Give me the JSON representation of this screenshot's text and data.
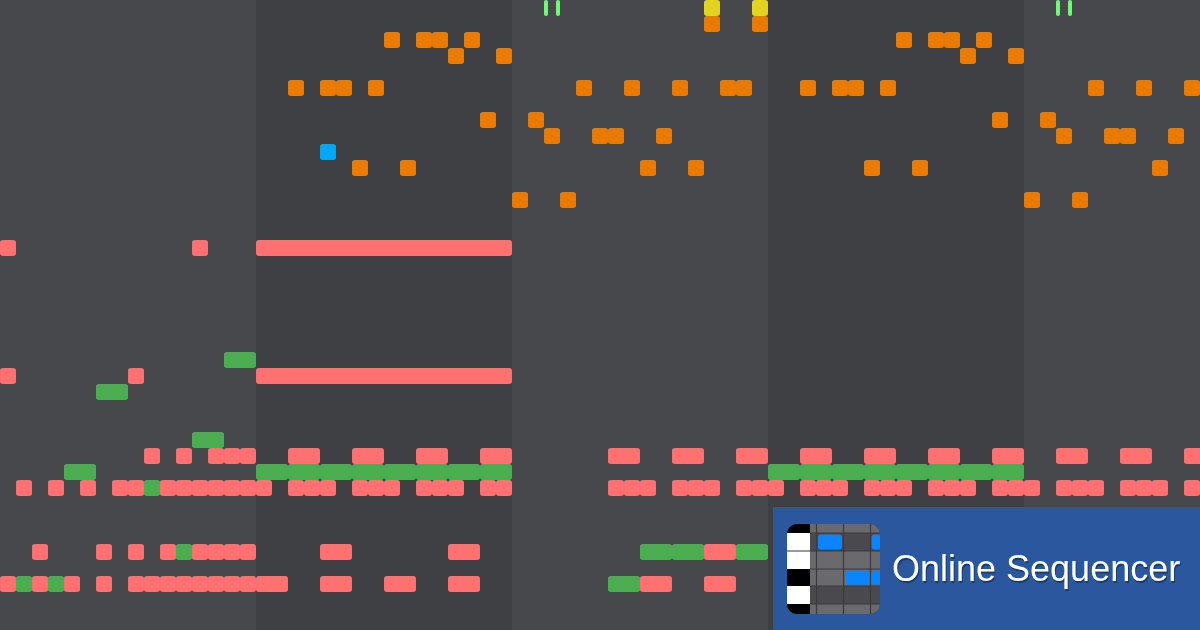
{
  "brand": {
    "name": "Online Sequencer"
  }
}
